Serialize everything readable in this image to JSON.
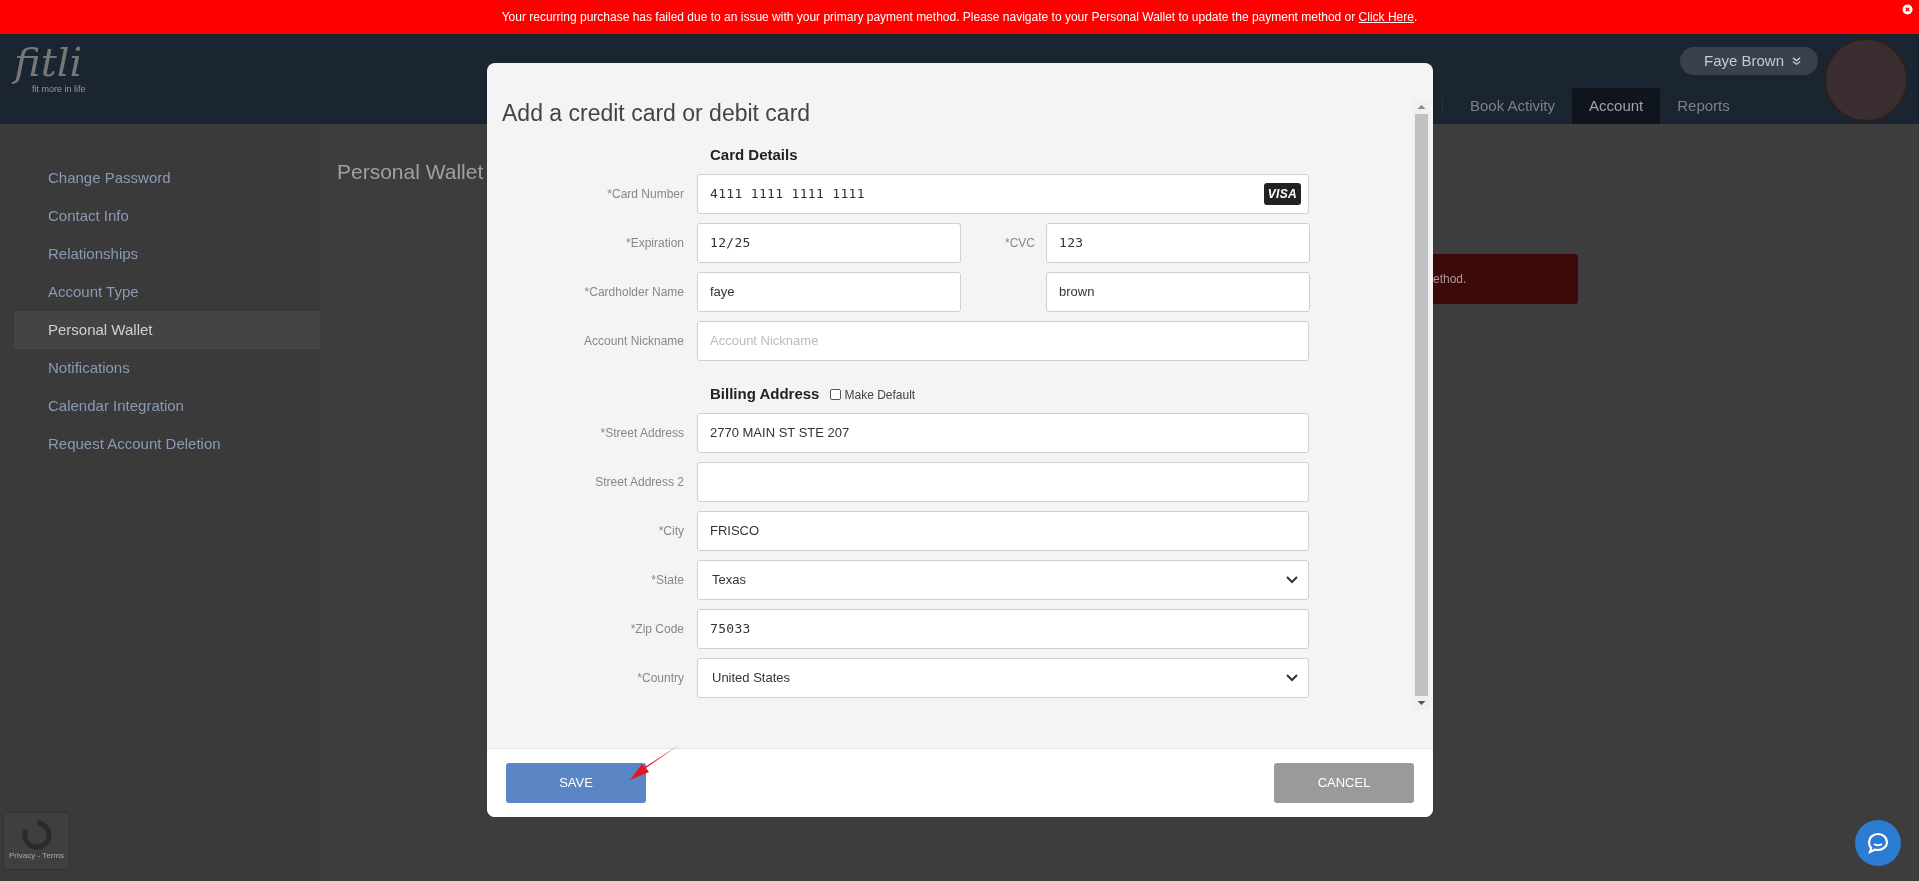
{
  "banner": {
    "message": "Your recurring purchase has failed due to an issue with your primary payment method. Please navigate to your Personal Wallet to update the payment method or ",
    "link": "Click Here",
    "suffix": "."
  },
  "header": {
    "logo": {
      "wordmark": "fitli",
      "tagline": "fit more in life"
    },
    "user_menu": "Faye Brown",
    "nav": [
      {
        "label": "Book Activity",
        "selected": false
      },
      {
        "label": "Account",
        "selected": true
      },
      {
        "label": "Reports",
        "selected": false
      }
    ]
  },
  "sidebar": {
    "items": [
      {
        "label": "Change Password",
        "selected": false
      },
      {
        "label": "Contact Info",
        "selected": false
      },
      {
        "label": "Relationships",
        "selected": false
      },
      {
        "label": "Account Type",
        "selected": false
      },
      {
        "label": "Personal Wallet",
        "selected": true
      },
      {
        "label": "Notifications",
        "selected": false
      },
      {
        "label": "Calendar Integration",
        "selected": false
      },
      {
        "label": "Request Account Deletion",
        "selected": false
      }
    ]
  },
  "page": {
    "title": "Personal Wallet",
    "alert_text": "ethod."
  },
  "modal": {
    "title": "Add a credit card or debit card",
    "sections": [
      {
        "heading": "Card Details",
        "rows": [
          {
            "label": "*Card Number",
            "fields": [
              {
                "kind": "text",
                "value": "4111 1111 1111 1111",
                "mono": true,
                "brand": "VISA"
              }
            ]
          },
          {
            "label": "*Expiration",
            "fields": [
              {
                "kind": "text",
                "value": "12/25",
                "mono": true
              },
              {
                "kind": "text",
                "label": "*CVC",
                "value": "123",
                "mono": true
              }
            ]
          },
          {
            "label": "*Cardholder Name",
            "fields": [
              {
                "kind": "text",
                "value": "faye",
                "mono": false
              },
              {
                "kind": "text",
                "value": "brown",
                "mono": false
              }
            ]
          },
          {
            "label": "Account Nickname",
            "fields": [
              {
                "kind": "text",
                "placeholder": "Account Nickname",
                "mono": false
              }
            ]
          }
        ]
      },
      {
        "heading": "Billing Address",
        "option": {
          "label": "Make Default",
          "checked": false
        },
        "rows": [
          {
            "label": "*Street Address",
            "fields": [
              {
                "kind": "text",
                "value": "2770 MAIN ST STE 207",
                "mono": false
              }
            ]
          },
          {
            "label": "Street Address 2",
            "fields": [
              {
                "kind": "text"
              }
            ]
          },
          {
            "label": "*City",
            "fields": [
              {
                "kind": "text",
                "value": "FRISCO",
                "mono": false
              }
            ]
          },
          {
            "label": "*State",
            "fields": [
              {
                "kind": "select",
                "value": "Texas",
                "mono": false
              }
            ]
          },
          {
            "label": "*Zip Code",
            "fields": [
              {
                "kind": "text",
                "value": "75033",
                "mono": true
              }
            ]
          },
          {
            "label": "*Country",
            "fields": [
              {
                "kind": "select",
                "value": "United States",
                "mono": false
              }
            ]
          }
        ]
      }
    ],
    "buttons": [
      {
        "kind": "primary",
        "label": "SAVE"
      },
      {
        "kind": "secondary",
        "label": "CANCEL"
      }
    ]
  },
  "recaptcha": {
    "text": "Privacy - Terms"
  }
}
